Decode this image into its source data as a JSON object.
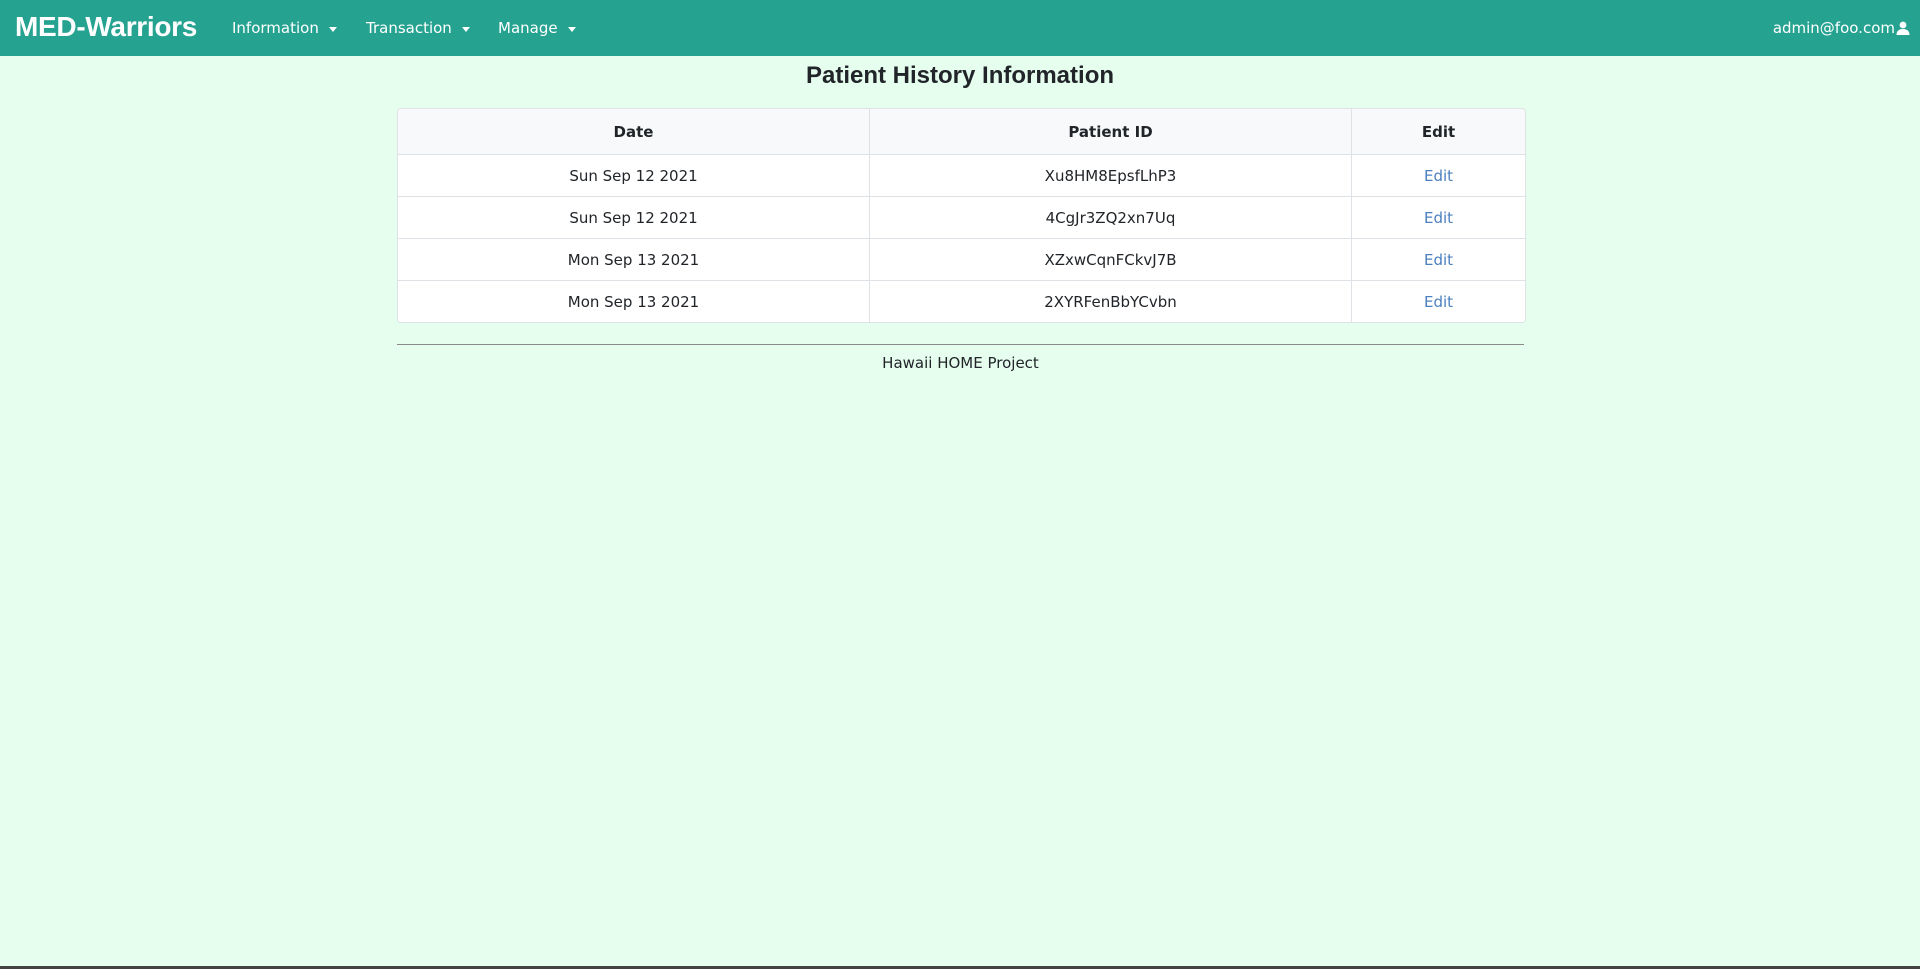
{
  "navbar": {
    "brand": "MED-Warriors",
    "menus": [
      {
        "label": "Information"
      },
      {
        "label": "Transaction"
      },
      {
        "label": "Manage"
      }
    ],
    "user": "admin@foo.com",
    "user_icon": "user-icon",
    "background_color": "#25a290"
  },
  "page": {
    "title": "Patient History Information",
    "background_color": "#e6feee"
  },
  "table": {
    "headers": [
      "Date",
      "Patient ID",
      "Edit"
    ],
    "rows": [
      {
        "date": "Sun Sep 12 2021",
        "patient_id": "Xu8HM8EpsfLhP3",
        "edit": "Edit"
      },
      {
        "date": "Sun Sep 12 2021",
        "patient_id": "4CgJr3ZQ2xn7Uq",
        "edit": "Edit"
      },
      {
        "date": "Mon Sep 13 2021",
        "patient_id": "XZxwCqnFCkvJ7B",
        "edit": "Edit"
      },
      {
        "date": "Mon Sep 13 2021",
        "patient_id": "2XYRFenBbYCvbn",
        "edit": "Edit"
      }
    ],
    "link_color": "#4b7fbf"
  },
  "footer": {
    "text": "Hawaii HOME Project"
  }
}
